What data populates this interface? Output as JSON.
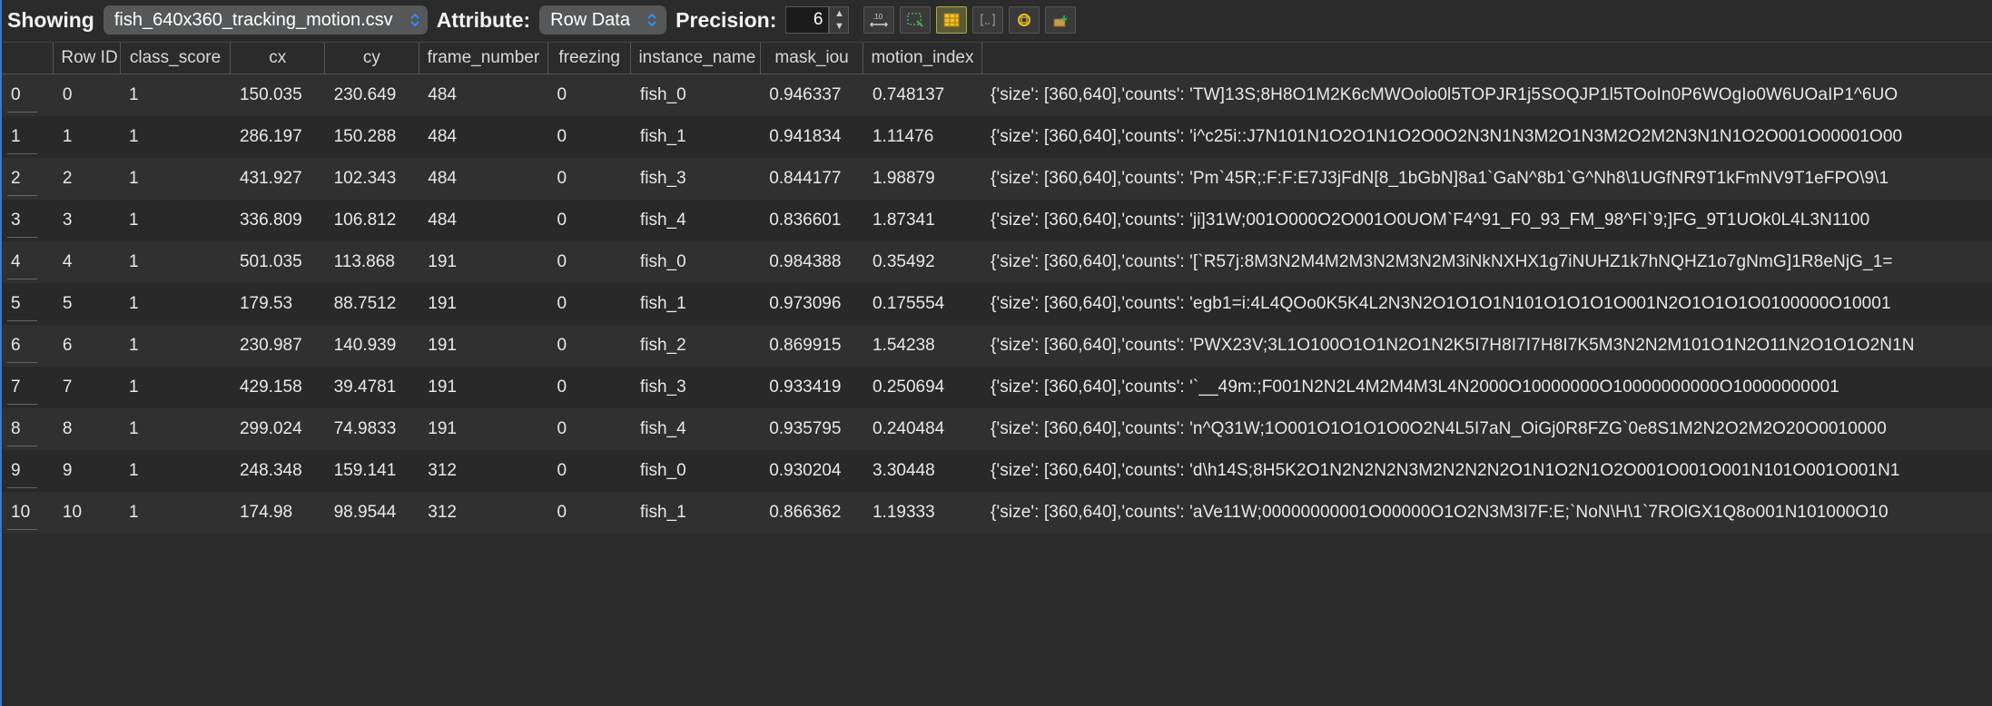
{
  "toolbar": {
    "showing_label": "Showing",
    "file_select_value": "fish_640x360_tracking_motion.csv",
    "attribute_label": "Attribute:",
    "attribute_select_value": "Row Data",
    "precision_label": "Precision:",
    "precision_value": "6"
  },
  "columns": [
    "",
    "Row ID",
    "class_score",
    "cx",
    "cy",
    "frame_number",
    "freezing",
    "instance_name",
    "mask_iou",
    "motion_index",
    ""
  ],
  "rows": [
    {
      "idx": "0",
      "row_id": "0",
      "class_score": "1",
      "cx": "150.035",
      "cy": "230.649",
      "frame_number": "484",
      "freezing": "0",
      "instance_name": "fish_0",
      "mask_iou": "0.946337",
      "motion_index": "0.748137",
      "rle": "{'size': [360,640],'counts': 'TW]13S;8H8O1M2K6cMWOolo0l5TOPJR1j5SOQJP1l5TOoIn0P6WOgIo0W6UOaIP1^6UO"
    },
    {
      "idx": "1",
      "row_id": "1",
      "class_score": "1",
      "cx": "286.197",
      "cy": "150.288",
      "frame_number": "484",
      "freezing": "0",
      "instance_name": "fish_1",
      "mask_iou": "0.941834",
      "motion_index": "1.11476",
      "rle": "{'size': [360,640],'counts': 'i^c25i::J7N101N1O2O1N1O2O0O2N3N1N3M2O1N3M2O2M2N3N1N1O2O001O00001O00"
    },
    {
      "idx": "2",
      "row_id": "2",
      "class_score": "1",
      "cx": "431.927",
      "cy": "102.343",
      "frame_number": "484",
      "freezing": "0",
      "instance_name": "fish_3",
      "mask_iou": "0.844177",
      "motion_index": "1.98879",
      "rle": "{'size': [360,640],'counts': 'Pm`45R;:F:F:E7J3jFdN[8_1bGbN]8a1`GaN^8b1`G^Nh8\\1UGfNR9T1kFmNV9T1eFPO\\9\\1"
    },
    {
      "idx": "3",
      "row_id": "3",
      "class_score": "1",
      "cx": "336.809",
      "cy": "106.812",
      "frame_number": "484",
      "freezing": "0",
      "instance_name": "fish_4",
      "mask_iou": "0.836601",
      "motion_index": "1.87341",
      "rle": "{'size': [360,640],'counts': 'ji]31W;001O000O2O001O0UOM`F4^91_F0_93_FM_98^FI`9;]FG_9T1UOk0L4L3N1100"
    },
    {
      "idx": "4",
      "row_id": "4",
      "class_score": "1",
      "cx": "501.035",
      "cy": "113.868",
      "frame_number": "191",
      "freezing": "0",
      "instance_name": "fish_0",
      "mask_iou": "0.984388",
      "motion_index": "0.35492",
      "rle": "{'size': [360,640],'counts': '[`R57j:8M3N2M4M2M3N2M3N2M3iNkNXHX1g7iNUHZ1k7hNQHZ1o7gNmG]1R8eNjG_1="
    },
    {
      "idx": "5",
      "row_id": "5",
      "class_score": "1",
      "cx": "179.53",
      "cy": "88.7512",
      "frame_number": "191",
      "freezing": "0",
      "instance_name": "fish_1",
      "mask_iou": "0.973096",
      "motion_index": "0.175554",
      "rle": "{'size': [360,640],'counts': 'egb1=i:4L4QOo0K5K4L2N3N2O1O1O1N101O1O1O1O001N2O1O1O1O0100000O10001"
    },
    {
      "idx": "6",
      "row_id": "6",
      "class_score": "1",
      "cx": "230.987",
      "cy": "140.939",
      "frame_number": "191",
      "freezing": "0",
      "instance_name": "fish_2",
      "mask_iou": "0.869915",
      "motion_index": "1.54238",
      "rle": "{'size': [360,640],'counts': 'PWX23V;3L1O100O1O1N2O1N2K5I7H8I7I7H8I7K5M3N2N2M101O1N2O11N2O1O1O2N1N"
    },
    {
      "idx": "7",
      "row_id": "7",
      "class_score": "1",
      "cx": "429.158",
      "cy": "39.4781",
      "frame_number": "191",
      "freezing": "0",
      "instance_name": "fish_3",
      "mask_iou": "0.933419",
      "motion_index": "0.250694",
      "rle": "{'size': [360,640],'counts': '`__49m:;F001N2N2L4M2M4M3L4N2000O10000000O10000000000O10000000001"
    },
    {
      "idx": "8",
      "row_id": "8",
      "class_score": "1",
      "cx": "299.024",
      "cy": "74.9833",
      "frame_number": "191",
      "freezing": "0",
      "instance_name": "fish_4",
      "mask_iou": "0.935795",
      "motion_index": "0.240484",
      "rle": "{'size': [360,640],'counts': 'n^Q31W;1O001O1O1O1O0O2N4L5I7aN_OiGj0R8FZG`0e8S1M2N2O2M2O20O0010000"
    },
    {
      "idx": "9",
      "row_id": "9",
      "class_score": "1",
      "cx": "248.348",
      "cy": "159.141",
      "frame_number": "312",
      "freezing": "0",
      "instance_name": "fish_0",
      "mask_iou": "0.930204",
      "motion_index": "3.30448",
      "rle": "{'size': [360,640],'counts': 'd\\h14S;8H5K2O1N2N2N2N3M2N2N2N2O1N1O2N1O2O001O001O001N101O001O001N1"
    },
    {
      "idx": "10",
      "row_id": "10",
      "class_score": "1",
      "cx": "174.98",
      "cy": "98.9544",
      "frame_number": "312",
      "freezing": "0",
      "instance_name": "fish_1",
      "mask_iou": "0.866362",
      "motion_index": "1.19333",
      "rle": "{'size': [360,640],'counts': 'aVe11W;00000000001O00000O1O2N3M3I7F:E;`NoN\\H\\1`7ROlGX1Q8o001N101000O10"
    }
  ]
}
